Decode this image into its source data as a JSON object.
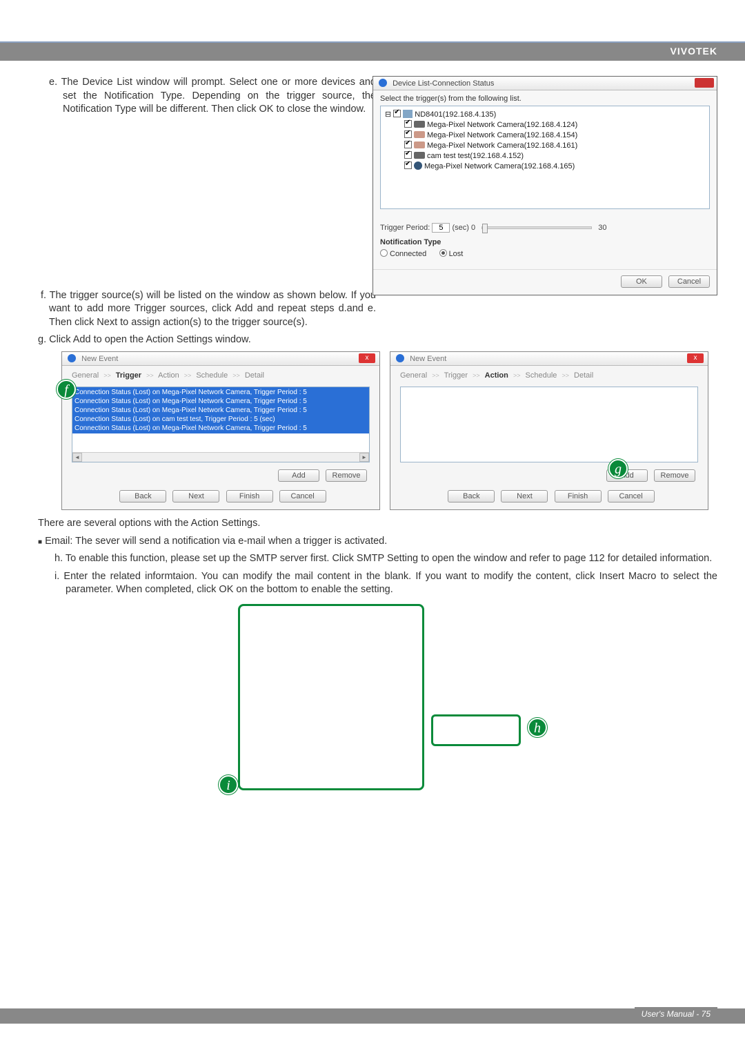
{
  "header": {
    "brand": "VIVOTEK"
  },
  "steps": {
    "e": "e. The Device List window will prompt. Select one or more devices and set the Notification Type. Depending on the trigger source, the Notification Type will be different. Then click OK to close the window.",
    "f": "f. The trigger source(s) will be listed on the window as shown below. If you want to add more Trigger sources, click Add and repeat steps d.and e. Then click Next to assign action(s) to the trigger source(s).",
    "g": "g. Click Add to open the Action Settings window.",
    "action_intro": "There are several options with the Action Settings.",
    "email_bullet": "Email: The sever will send a notification via e-mail when a trigger is activated.",
    "h": "h. To enable this function, please set up the SMTP server first. Click SMTP Setting to open the window and refer to page 112 for detailed information.",
    "i": "i. Enter the related informtaion. You can modify the mail content in the blank. If you want to modify the content, click Insert Macro to select the parameter. When completed, click OK on the bottom to enable the setting."
  },
  "device_list": {
    "title": "Device List-Connection Status",
    "prompt": "Select the trigger(s) from the following list.",
    "root": "ND8401(192.168.4.135)",
    "items": [
      "Mega-Pixel Network Camera(192.168.4.124)",
      "Mega-Pixel Network Camera(192.168.4.154)",
      "Mega-Pixel Network Camera(192.168.4.161)",
      "cam test test(192.168.4.152)",
      "Mega-Pixel Network Camera(192.168.4.165)"
    ],
    "trigger_period_label": "Trigger Period:",
    "trigger_period_value": "5",
    "trigger_period_unit": "(sec)",
    "slider_min": "0",
    "slider_max": "30",
    "notif_type_label": "Notification Type",
    "connected": "Connected",
    "lost": "Lost",
    "ok": "OK",
    "cancel": "Cancel"
  },
  "event_win": {
    "title": "New Event",
    "x": "x",
    "crumbs": [
      "General",
      "Trigger",
      "Action",
      "Schedule",
      "Detail"
    ],
    "sep": ">>",
    "lines": [
      "Connection Status (Lost)  on Mega-Pixel Network Camera,  Trigger Period : 5",
      "Connection Status (Lost)  on Mega-Pixel Network Camera,  Trigger Period : 5",
      "Connection Status (Lost)  on Mega-Pixel Network Camera,  Trigger Period : 5",
      "Connection Status (Lost)  on cam test test,  Trigger Period : 5 (sec)",
      "Connection Status (Lost)  on Mega-Pixel Network Camera,  Trigger Period : 5"
    ],
    "scroll_l": "◄",
    "scroll_r": "►",
    "add": "Add",
    "remove": "Remove",
    "back": "Back",
    "next": "Next",
    "finish": "Finish",
    "cancel": "Cancel"
  },
  "badges": {
    "f": "f",
    "g": "g",
    "h": "h",
    "i": "i"
  },
  "footer": {
    "text": "User's Manual - 75"
  }
}
